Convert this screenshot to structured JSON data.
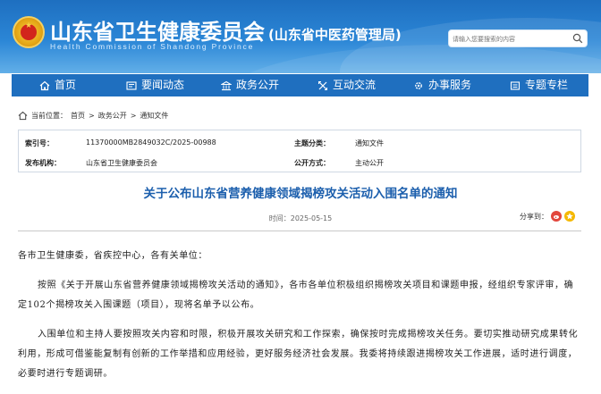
{
  "header": {
    "site_title": "山东省卫生健康委员会",
    "site_subtitle": "(山东省中医药管理局)",
    "site_title_en": "Health Commission of Shandong Province",
    "search_placeholder": "请输入您要搜索的内容",
    "search_icon": "search-icon",
    "emblem_icon": "national-emblem-icon",
    "colors": {
      "header_top": "#1e6fc0",
      "header_bottom": "#62afe8",
      "nav": "#1f6fbf",
      "title_blue": "#1c5fad"
    }
  },
  "nav": {
    "items": [
      {
        "label": "首页",
        "icon": "home-icon"
      },
      {
        "label": "要闻动态",
        "icon": "news-icon"
      },
      {
        "label": "政务公开",
        "icon": "building-icon"
      },
      {
        "label": "互动交流",
        "icon": "interaction-icon"
      },
      {
        "label": "办事服务",
        "icon": "service-icon"
      },
      {
        "label": "专题专栏",
        "icon": "column-icon"
      }
    ]
  },
  "breadcrumb": {
    "prefix": "当前位置：",
    "items": [
      "首页",
      "政务公开",
      "通知文件"
    ],
    "separator": ">"
  },
  "meta": {
    "index_label": "索引号：",
    "index_value": "11370000MB2849032C/2025-00988",
    "category_label": "主题分类：",
    "category_value": "通知文件",
    "publisher_label": "发布机构：",
    "publisher_value": "山东省卫生健康委员会",
    "method_label": "公开方式：",
    "method_value": "主动公开"
  },
  "article": {
    "title": "关于公布山东省营养健康领域揭榜攻关活动入围名单的通知",
    "date": "时间：2025-05-15",
    "share_label": "分享到：",
    "salutation": "各市卫生健康委，省疾控中心，各有关单位：",
    "paragraph1": "按照《关于开展山东省营养健康领域揭榜攻关活动的通知》，各市各单位积极组织揭榜攻关项目和课题申报，经组织专家评审，确定102个揭榜攻关入围课题（项目），现将名单予以公布。",
    "paragraph2": "入围单位和主持人要按照攻关内容和时限，积极开展攻关研究和工作探索，确保按时完成揭榜攻关任务。要切实推动研究成果转化利用，形成可借鉴能复制有创新的工作举措和应用经验，更好服务经济社会发展。我委将持续跟进揭榜攻关工作进展，适时进行调度，必要时进行专题调研。"
  }
}
